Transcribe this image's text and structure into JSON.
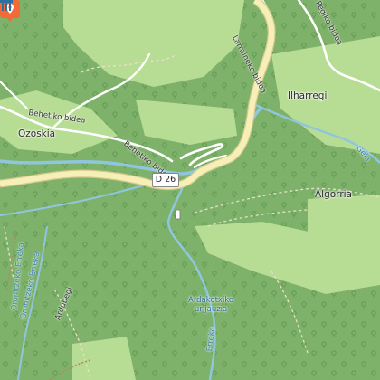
{
  "map": {
    "places": {
      "ozoskia": "Ozoskia",
      "ilharregi": "Ilharregi",
      "algorria": "Algorria"
    },
    "roads": {
      "d26_badge": "D 26",
      "larraineko_bidea": "Larraineko bidea",
      "behetiko_bidea_1": "Behetiko bidea",
      "behetiko_bidea_2": "Behetiko bidea",
      "pegiko_bidea": "Pegiko bidea",
      "ardubegi": "Ardubegi"
    },
    "waterways": {
      "oronitzeko_erreka_1": "Oronitzeko Erreka",
      "oronitzeko_erreka_2": "Oronitzeko Erreka",
      "gela": "Gela",
      "erreka_bottom": "Erreka"
    },
    "poi": {
      "waterfall_line1": "Ardakotxiko",
      "waterfall_line2": "ur-jauzia"
    },
    "colors": {
      "forest": "#7eb16a",
      "meadow": "#b7dc93",
      "road_fill": "#f6efb7",
      "road_casing": "#d6c98e",
      "river": "#8fc6dd",
      "track": "#ffffff",
      "marker": "#f26b34"
    },
    "icons": [
      "map-marker-icon",
      "waterfall-icon",
      "tree-symbol-icon"
    ]
  }
}
